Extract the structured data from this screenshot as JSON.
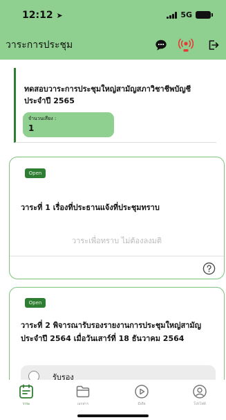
{
  "status_bar": {
    "time": "12:12",
    "network": "5G"
  },
  "header": {
    "title": "วาระการประชุม"
  },
  "meeting": {
    "title": "ทดสอบวาระการประชุมใหญ่สามัญสภาวิชาชีพบัญชี ประจำปี 2565",
    "votes_label": "จำนวนเสียง :",
    "votes_value": "1"
  },
  "agendas": [
    {
      "status": "Open",
      "text": "วาระที่ 1 เรื่องที่ประธานแจ้งที่ประชุมทราบ",
      "note": "วาระเพื่อทราบ ไม่ต้องลงมติ"
    },
    {
      "status": "Open",
      "text": "วาระที่ 2 พิจารณารับรองรายงานการประชุมใหญ่สามัญประจำปี 2564 เมื่อวันเสาร์ที่ 18 ธันวาคม 2564",
      "options": [
        "รับรอง"
      ]
    }
  ],
  "tabs": [
    {
      "label": "วาระ",
      "icon": "agenda-icon",
      "active": true
    },
    {
      "label": "เอกสาร",
      "icon": "folder-icon",
      "active": false
    },
    {
      "label": "มีเดีย",
      "icon": "play-icon",
      "active": false
    },
    {
      "label": "โปรไฟล์",
      "icon": "profile-icon",
      "active": false
    }
  ],
  "colors": {
    "accent": "#8fcf8f",
    "dark_green": "#2e7d32",
    "live_red": "#e53935"
  }
}
